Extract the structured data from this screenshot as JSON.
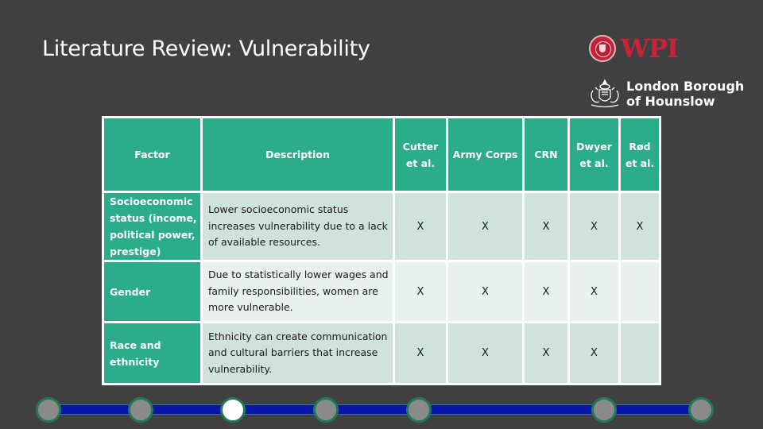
{
  "slide": {
    "title": "Literature Review: Vulnerability"
  },
  "logos": {
    "wpi": {
      "text": "WPI",
      "icon": "wpi-seal-icon",
      "color": "#c8233a"
    },
    "hounslow": {
      "line1": "London Borough",
      "line2": "of Hounslow",
      "icon": "borough-crest-icon"
    }
  },
  "table": {
    "headers": {
      "factor": "Factor",
      "description": "Description",
      "sources": [
        {
          "line1": "Cutter",
          "line2": "et al."
        },
        {
          "line1": "Army Corps",
          "line2": ""
        },
        {
          "line1": "CRN",
          "line2": ""
        },
        {
          "line1": "Dwyer",
          "line2": "et al."
        },
        {
          "line1": "Rød",
          "line2": "et al."
        }
      ]
    },
    "rows": [
      {
        "factor": "Socioeconomic status (income, political power, prestige)",
        "description": "Lower socioeconomic status increases vulnerability due to a lack of available resources.",
        "marks": [
          "X",
          "X",
          "X",
          "X",
          "X"
        ]
      },
      {
        "factor": "Gender",
        "description": "Due to statistically lower wages and family responsibilities, women are more vulnerable.",
        "marks": [
          "X",
          "X",
          "X",
          "X",
          ""
        ]
      },
      {
        "factor": "Race and ethnicity",
        "description": "Ethnicity can create communication and cultural barriers that increase vulnerability.",
        "marks": [
          "X",
          "X",
          "X",
          "X",
          ""
        ]
      }
    ],
    "colors": {
      "header_bg": "#2bad8c",
      "row_dark": "#cfe2dc",
      "row_light": "#e8f1ee"
    }
  },
  "navigation": {
    "total_steps": 8,
    "current_step": 3,
    "colors": {
      "track": "#0a14a8",
      "dot": "#8a8a8a",
      "active_dot": "#ffffff",
      "dot_border": "#1f7a5c"
    }
  }
}
